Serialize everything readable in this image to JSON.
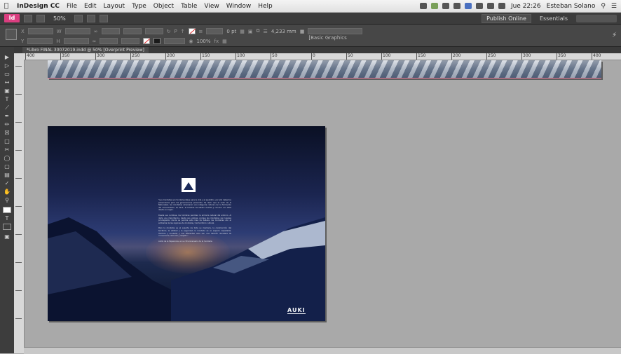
{
  "menubar": {
    "app": "InDesign CC",
    "items": [
      "File",
      "Edit",
      "Layout",
      "Type",
      "Object",
      "Table",
      "View",
      "Window",
      "Help"
    ],
    "clock": "Jue 22:26",
    "user": "Esteban Solano"
  },
  "appbar": {
    "logo": "Id",
    "zoom": "50%",
    "publish": "Publish Online",
    "workspace": "Essentials"
  },
  "control": {
    "stroke_weight": "0 pt",
    "ref_size": "4,233 mm",
    "opacity": "100%",
    "style": "[Basic Graphics Frame]+"
  },
  "document": {
    "tab": "*Libro FINAL 30072019.indd @ 50% [Overprint Preview]"
  },
  "ruler": {
    "ticks": [
      "400",
      "350",
      "300",
      "250",
      "200",
      "150",
      "100",
      "50",
      "0",
      "50",
      "100",
      "150",
      "200",
      "250",
      "300",
      "350",
      "400"
    ]
  },
  "spread": {
    "brand": "AUKI",
    "paragraphs": [
      "\"Las montañas son fundamentales para la vida y el equilibrio, por ello debemos preservarlas para las generaciones presentes. Es decir que el valor de la Naturaleza, las montañas alcanzarán una categoría cultural con la formación del conocimiento, es decir, el hombre ha sabido vivirlas y convivir con ellas desde su origen.",
      "Desde sus cumbres, los hombres perciben la armonía natural del entorno. Al darle una importancia, desde sus valores, porque las montañas son lugares privilegiados donde se percibe esta idea de belleza, las montañas son el emblema de las regiones de montaña y del territorio cultural.",
      "Pero la montaña es el soporte de toda su memoria, la construcción del territorio, la utilidad y la seguridad; la montaña es un espacio respetable. Hombre y montaña y sus diferentes usos son una relación duradera de convivencia, armonía y respeto.\"",
      "Anillo de la Esperanza, en su 30 aniversario de la montaña."
    ]
  }
}
